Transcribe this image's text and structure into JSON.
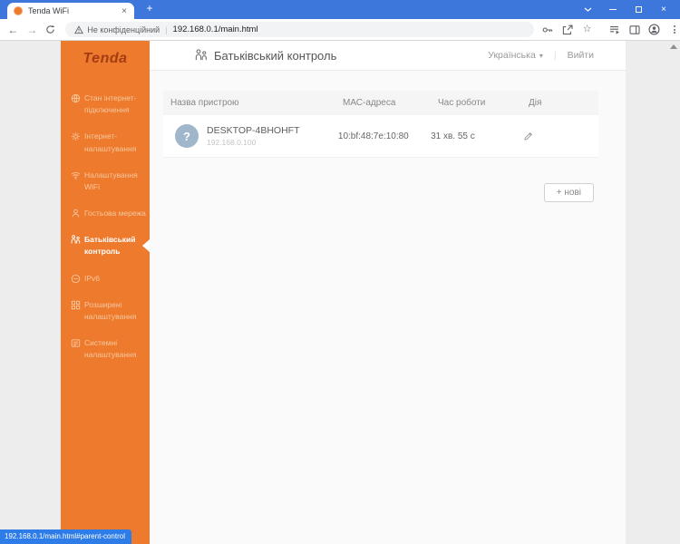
{
  "browser": {
    "tab": {
      "title": "Tenda WiFi"
    },
    "address": {
      "warning": "Не конфіденційний",
      "divider": "|",
      "url": "192.168.0.1/main.html"
    },
    "status_bubble": "192.168.0.1/main.html#parent-control"
  },
  "glyphs": {
    "back": "←",
    "forward": "→",
    "tab_close": "×",
    "window_close": "×",
    "new_tab": "+",
    "star": "☆",
    "caret_down": "▾",
    "question_mark": "?",
    "divider": "|"
  },
  "sidebar": {
    "logo": "Tenda",
    "items": [
      {
        "label": "Стан інтернет-підключення",
        "icon": "globe-icon"
      },
      {
        "label": "Інтернет-налаштування",
        "icon": "gear-icon"
      },
      {
        "label": "Налаштування WiFi",
        "icon": "wifi-icon"
      },
      {
        "label": "Гостьова мережа",
        "icon": "guest-icon"
      },
      {
        "label": "Батьківський контроль",
        "icon": "family-icon"
      },
      {
        "label": "IPv6",
        "icon": "ipv6-icon"
      },
      {
        "label": "Розширені налаштування",
        "icon": "grid-icon"
      },
      {
        "label": "Системні налаштування",
        "icon": "system-icon"
      }
    ]
  },
  "header": {
    "title": "Батьківський контроль",
    "language": "Українська",
    "logout": "Вийти"
  },
  "table": {
    "columns": [
      "Назва пристрою",
      "МАС-адреса",
      "Час роботи",
      "Дія"
    ],
    "rows": [
      {
        "device_name": "DESKTOP-4BHOHFT",
        "ip": "192.168.0.100",
        "mac": "10:bf:48:7e:10:80",
        "uptime": "31 хв. 55 с"
      }
    ]
  },
  "actions": {
    "add_button": "+ нові"
  },
  "colors": {
    "sidebar_orange": "#ee7b2d",
    "titlebar_blue": "#3d77dc",
    "status_bubble_blue": "#2d7ce8",
    "avatar_gray_blue": "#a0b7cb",
    "logo_dark_red": "#a33c14"
  }
}
